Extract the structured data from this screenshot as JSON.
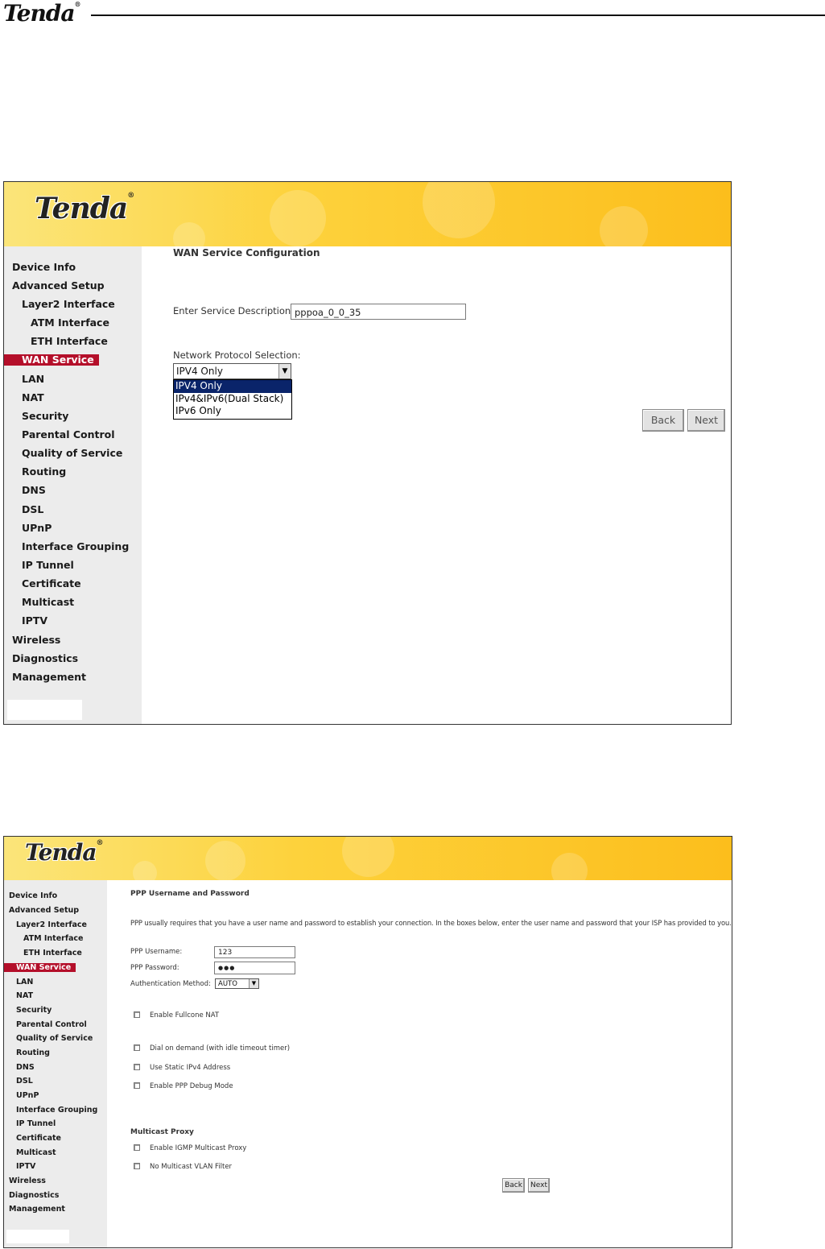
{
  "doc_header": {
    "logo": "Tenda",
    "reg": "®"
  },
  "screen1": {
    "brand": "Tenda",
    "reg": "®",
    "sidebar": [
      {
        "label": "Device Info"
      },
      {
        "label": "Advanced Setup"
      },
      {
        "label": "Layer2 Interface"
      },
      {
        "label": "ATM Interface"
      },
      {
        "label": "ETH Interface"
      },
      {
        "label": "WAN Service"
      },
      {
        "label": "LAN"
      },
      {
        "label": "NAT"
      },
      {
        "label": "Security"
      },
      {
        "label": "Parental Control"
      },
      {
        "label": "Quality of Service"
      },
      {
        "label": "Routing"
      },
      {
        "label": "DNS"
      },
      {
        "label": "DSL"
      },
      {
        "label": "UPnP"
      },
      {
        "label": "Interface Grouping"
      },
      {
        "label": "IP Tunnel"
      },
      {
        "label": "Certificate"
      },
      {
        "label": "Multicast"
      },
      {
        "label": "IPTV"
      },
      {
        "label": "Wireless"
      },
      {
        "label": "Diagnostics"
      },
      {
        "label": "Management"
      }
    ],
    "title": "WAN Service Configuration",
    "service_description_label": "Enter Service Description:",
    "service_description_value": "pppoa_0_0_35",
    "protocol_label": "Network Protocol Selection:",
    "protocol_selected": "IPV4 Only",
    "protocol_options": [
      "IPV4 Only",
      "IPv4&IPv6(Dual Stack)",
      "IPv6 Only"
    ],
    "back": "Back",
    "next": "Next"
  },
  "screen2": {
    "brand": "Tenda",
    "reg": "®",
    "sidebar": [
      {
        "label": "Device Info"
      },
      {
        "label": "Advanced Setup"
      },
      {
        "label": "Layer2 Interface"
      },
      {
        "label": "ATM Interface"
      },
      {
        "label": "ETH Interface"
      },
      {
        "label": "WAN Service"
      },
      {
        "label": "LAN"
      },
      {
        "label": "NAT"
      },
      {
        "label": "Security"
      },
      {
        "label": "Parental Control"
      },
      {
        "label": "Quality of Service"
      },
      {
        "label": "Routing"
      },
      {
        "label": "DNS"
      },
      {
        "label": "DSL"
      },
      {
        "label": "UPnP"
      },
      {
        "label": "Interface Grouping"
      },
      {
        "label": "IP Tunnel"
      },
      {
        "label": "Certificate"
      },
      {
        "label": "Multicast"
      },
      {
        "label": "IPTV"
      },
      {
        "label": "Wireless"
      },
      {
        "label": "Diagnostics"
      },
      {
        "label": "Management"
      }
    ],
    "title": "PPP Username and Password",
    "intro": "PPP usually requires that you have a user name and password to establish your connection. In the boxes below, enter the user name and password that your ISP has provided to you.",
    "username_label": "PPP Username:",
    "username_value": "123",
    "password_label": "PPP Password:",
    "password_value": "●●●",
    "auth_label": "Authentication Method:",
    "auth_value": "AUTO",
    "fullcone": "Enable Fullcone NAT",
    "dial_on_demand": "Dial on demand (with idle timeout timer)",
    "static_ipv4": "Use Static IPv4 Address",
    "ppp_debug": "Enable PPP Debug Mode",
    "multicast_title": "Multicast Proxy",
    "igmp": "Enable IGMP Multicast Proxy",
    "no_vlan_filter": "No Multicast VLAN Filter",
    "back": "Back",
    "next": "Next"
  }
}
